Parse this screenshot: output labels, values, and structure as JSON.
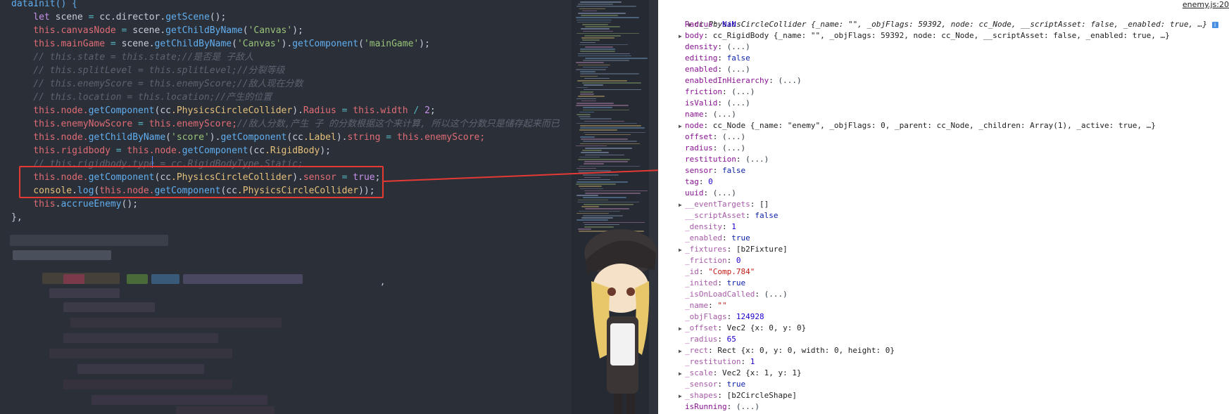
{
  "editor": {
    "lines": [
      {
        "segments": [
          {
            "t": "dataInit() {",
            "c": "fn"
          }
        ]
      },
      {
        "segments": [
          {
            "t": "    let ",
            "c": "kw"
          },
          {
            "t": "scene",
            "c": "plain"
          },
          {
            "t": " = ",
            "c": "op"
          },
          {
            "t": "cc",
            "c": "plain"
          },
          {
            "t": ".director.",
            "c": "plain"
          },
          {
            "t": "getScene",
            "c": "fn"
          },
          {
            "t": "();",
            "c": "plain"
          }
        ]
      },
      {
        "segments": [
          {
            "t": "    this",
            "c": "this"
          },
          {
            "t": ".canvasNode",
            "c": "prop"
          },
          {
            "t": " = ",
            "c": "op"
          },
          {
            "t": "scene.",
            "c": "plain"
          },
          {
            "t": "getChildByName",
            "c": "fn"
          },
          {
            "t": "(",
            "c": "plain"
          },
          {
            "t": "'Canvas'",
            "c": "str"
          },
          {
            "t": ");",
            "c": "plain"
          }
        ]
      },
      {
        "segments": [
          {
            "t": "    this",
            "c": "this"
          },
          {
            "t": ".mainGame",
            "c": "prop"
          },
          {
            "t": " = ",
            "c": "op"
          },
          {
            "t": "scene.",
            "c": "plain"
          },
          {
            "t": "getChildByName",
            "c": "fn"
          },
          {
            "t": "(",
            "c": "plain"
          },
          {
            "t": "'Canvas'",
            "c": "str"
          },
          {
            "t": ").",
            "c": "plain"
          },
          {
            "t": "getComponent",
            "c": "fn"
          },
          {
            "t": "(",
            "c": "plain"
          },
          {
            "t": "'mainGame'",
            "c": "str"
          },
          {
            "t": ");",
            "c": "plain"
          }
        ]
      },
      {
        "segments": [
          {
            "t": "    // this.state = this.state;//是否是 子敌人",
            "c": "cm"
          }
        ]
      },
      {
        "segments": [
          {
            "t": "    // this.splitLevel = this.splitLevel;//分裂等级",
            "c": "cm"
          }
        ]
      },
      {
        "segments": [
          {
            "t": "    // this.enemyScore = this.enemyScore;//敌人现在分数",
            "c": "cm"
          }
        ]
      },
      {
        "segments": [
          {
            "t": "    // this.location = this.location;//产生的位置",
            "c": "cm"
          }
        ]
      },
      {
        "segments": [
          {
            "t": "    this",
            "c": "this"
          },
          {
            "t": ".node.",
            "c": "prop"
          },
          {
            "t": "getComponent",
            "c": "fn"
          },
          {
            "t": "(",
            "c": "plain"
          },
          {
            "t": "cc",
            "c": "plain"
          },
          {
            "t": ".PhysicsCircleCollider",
            "c": "cls"
          },
          {
            "t": ").",
            "c": "plain"
          },
          {
            "t": "Radius",
            "c": "prop"
          },
          {
            "t": " = ",
            "c": "op"
          },
          {
            "t": "this",
            "c": "this"
          },
          {
            "t": ".width",
            "c": "prop"
          },
          {
            "t": " / ",
            "c": "op"
          },
          {
            "t": "2",
            "c": "num"
          },
          {
            "t": ";",
            "c": "plain"
          }
        ]
      },
      {
        "segments": [
          {
            "t": "    this",
            "c": "this"
          },
          {
            "t": ".enemyNowScore",
            "c": "prop"
          },
          {
            "t": " = ",
            "c": "op"
          },
          {
            "t": "this",
            "c": "this"
          },
          {
            "t": ".enemyScore;",
            "c": "prop"
          },
          {
            "t": "//敌人分数,产生 子 的分数根据这个来计算, 所以这个分数只是储存起来而已",
            "c": "cm"
          }
        ]
      },
      {
        "segments": [
          {
            "t": "    this",
            "c": "this"
          },
          {
            "t": ".node.",
            "c": "prop"
          },
          {
            "t": "getChildByName",
            "c": "fn"
          },
          {
            "t": "(",
            "c": "plain"
          },
          {
            "t": "'score'",
            "c": "str"
          },
          {
            "t": ").",
            "c": "plain"
          },
          {
            "t": "getComponent",
            "c": "fn"
          },
          {
            "t": "(",
            "c": "plain"
          },
          {
            "t": "cc",
            "c": "plain"
          },
          {
            "t": ".Label",
            "c": "cls"
          },
          {
            "t": ").",
            "c": "plain"
          },
          {
            "t": "string",
            "c": "prop"
          },
          {
            "t": " = ",
            "c": "op"
          },
          {
            "t": "this",
            "c": "this"
          },
          {
            "t": ".enemyScore;",
            "c": "prop"
          }
        ]
      },
      {
        "segments": [
          {
            "t": "    this",
            "c": "this"
          },
          {
            "t": ".rigidbody",
            "c": "prop"
          },
          {
            "t": " = ",
            "c": "op"
          },
          {
            "t": "this",
            "c": "this"
          },
          {
            "t": ".node.",
            "c": "prop"
          },
          {
            "t": "getComponent",
            "c": "fn"
          },
          {
            "t": "(",
            "c": "plain"
          },
          {
            "t": "cc",
            "c": "plain"
          },
          {
            "t": ".RigidBody",
            "c": "cls"
          },
          {
            "t": ");",
            "c": "plain"
          }
        ]
      },
      {
        "segments": [
          {
            "t": "    // this.rigidbody.type = cc.RigidBodyType.Static;",
            "c": "cm"
          }
        ]
      },
      {
        "segments": [
          {
            "t": "    this",
            "c": "this"
          },
          {
            "t": ".node.",
            "c": "prop"
          },
          {
            "t": "getComponent",
            "c": "fn"
          },
          {
            "t": "(",
            "c": "plain"
          },
          {
            "t": "cc",
            "c": "plain"
          },
          {
            "t": ".PhysicsCircleCollider",
            "c": "cls"
          },
          {
            "t": ").",
            "c": "plain"
          },
          {
            "t": "sensor",
            "c": "prop"
          },
          {
            "t": " = ",
            "c": "op"
          },
          {
            "t": "true",
            "c": "kw"
          },
          {
            "t": ";",
            "c": "plain"
          }
        ]
      },
      {
        "segments": [
          {
            "t": "    console",
            "c": "cls"
          },
          {
            "t": ".",
            "c": "plain"
          },
          {
            "t": "log",
            "c": "fn"
          },
          {
            "t": "(",
            "c": "plain"
          },
          {
            "t": "this",
            "c": "this"
          },
          {
            "t": ".node.",
            "c": "prop"
          },
          {
            "t": "getComponent",
            "c": "fn"
          },
          {
            "t": "(",
            "c": "plain"
          },
          {
            "t": "cc",
            "c": "plain"
          },
          {
            "t": ".PhysicsCircleCollider",
            "c": "cls"
          },
          {
            "t": "));",
            "c": "plain"
          }
        ]
      },
      {
        "segments": [
          {
            "t": "    this",
            "c": "this"
          },
          {
            "t": ".",
            "c": "plain"
          },
          {
            "t": "accrueEnemy",
            "c": "fn"
          },
          {
            "t": "();",
            "c": "plain"
          }
        ]
      },
      {
        "segments": [
          {
            "t": "},",
            "c": "plain"
          }
        ]
      }
    ],
    "trailing_comma": ","
  },
  "console": {
    "source_link": "enemy.js:20",
    "header": {
      "name": "cc_PhysicsCircleCollider",
      "summary": " {_name: \"\", _objFlags: 59392, node: cc_Node, __scriptAsset: false, _enabled: true, …}"
    },
    "rows": [
      {
        "arrow": "",
        "key": "Radius",
        "val": "NaN",
        "vt": "num"
      },
      {
        "arrow": "▶",
        "key": "body",
        "val": "cc_RigidBody {_name: \"\", _objFlags: 59392, node: cc_Node, __scriptAsset: false, _enabled: true, …}",
        "vt": "obj"
      },
      {
        "arrow": "",
        "key": "density",
        "val": "(...)",
        "vt": "gray"
      },
      {
        "arrow": "",
        "key": "editing",
        "val": "false",
        "vt": "bool"
      },
      {
        "arrow": "",
        "key": "enabled",
        "val": "(...)",
        "vt": "gray"
      },
      {
        "arrow": "",
        "key": "enabledInHierarchy",
        "val": "(...)",
        "vt": "gray"
      },
      {
        "arrow": "",
        "key": "friction",
        "val": "(...)",
        "vt": "gray"
      },
      {
        "arrow": "",
        "key": "isValid",
        "val": "(...)",
        "vt": "gray"
      },
      {
        "arrow": "",
        "key": "name",
        "val": "(...)",
        "vt": "gray"
      },
      {
        "arrow": "▶",
        "key": "node",
        "val": "cc_Node {_name: \"enemy\", _objFlags: 0, _parent: cc_Node, _children: Array(1), _active: true, …}",
        "vt": "obj"
      },
      {
        "arrow": "",
        "key": "offset",
        "val": "(...)",
        "vt": "gray"
      },
      {
        "arrow": "",
        "key": "radius",
        "val": "(...)",
        "vt": "gray"
      },
      {
        "arrow": "",
        "key": "restitution",
        "val": "(...)",
        "vt": "gray"
      },
      {
        "arrow": "",
        "key": "sensor",
        "val": "false",
        "vt": "bool"
      },
      {
        "arrow": "",
        "key": "tag",
        "val": "0",
        "vt": "num"
      },
      {
        "arrow": "",
        "key": "uuid",
        "val": "(...)",
        "vt": "gray"
      },
      {
        "arrow": "▶",
        "key": "__eventTargets",
        "val": "[]",
        "vt": "obj"
      },
      {
        "arrow": "",
        "key": "__scriptAsset",
        "val": "false",
        "vt": "bool"
      },
      {
        "arrow": "",
        "key": "_density",
        "val": "1",
        "vt": "num"
      },
      {
        "arrow": "",
        "key": "_enabled",
        "val": "true",
        "vt": "bool"
      },
      {
        "arrow": "▶",
        "key": "_fixtures",
        "val": "[b2Fixture]",
        "vt": "obj"
      },
      {
        "arrow": "",
        "key": "_friction",
        "val": "0",
        "vt": "num"
      },
      {
        "arrow": "",
        "key": "_id",
        "val": "\"Comp.784\"",
        "vt": "str"
      },
      {
        "arrow": "",
        "key": "_inited",
        "val": "true",
        "vt": "bool"
      },
      {
        "arrow": "",
        "key": "_isOnLoadCalled",
        "val": "(...)",
        "vt": "gray"
      },
      {
        "arrow": "",
        "key": "_name",
        "val": "\"\"",
        "vt": "str"
      },
      {
        "arrow": "",
        "key": "_objFlags",
        "val": "124928",
        "vt": "num"
      },
      {
        "arrow": "▶",
        "key": "_offset",
        "val": "Vec2 {x: 0, y: 0}",
        "vt": "obj"
      },
      {
        "arrow": "",
        "key": "_radius",
        "val": "65",
        "vt": "num"
      },
      {
        "arrow": "▶",
        "key": "_rect",
        "val": "Rect {x: 0, y: 0, width: 0, height: 0}",
        "vt": "obj"
      },
      {
        "arrow": "",
        "key": "_restitution",
        "val": "1",
        "vt": "num"
      },
      {
        "arrow": "▶",
        "key": "_scale",
        "val": "Vec2 {x: 1, y: 1}",
        "vt": "obj"
      },
      {
        "arrow": "",
        "key": "_sensor",
        "val": "true",
        "vt": "bool"
      },
      {
        "arrow": "▶",
        "key": "_shapes",
        "val": "[b2CircleShape]",
        "vt": "obj"
      },
      {
        "arrow": "",
        "key": "isRunning",
        "val": "(...)",
        "vt": "gray"
      }
    ]
  },
  "colors": {
    "highlight": "#e53935",
    "arrow": "#e53935",
    "editor_bg": "#2b2f38"
  }
}
